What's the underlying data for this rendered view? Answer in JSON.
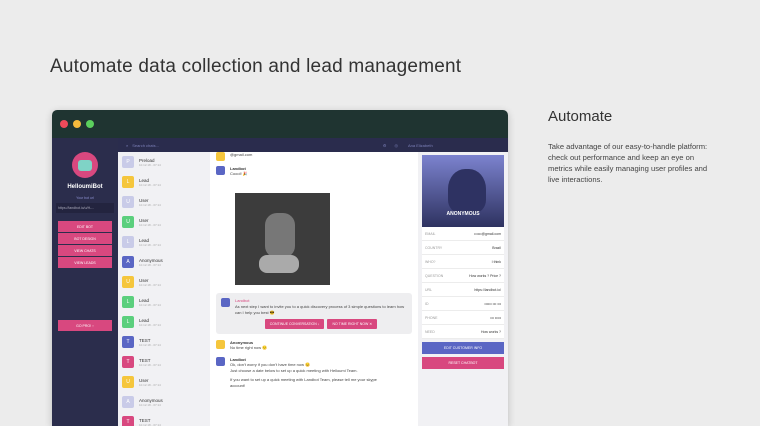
{
  "heading": "Automate data collection and lead management",
  "side": {
    "title": "Automate",
    "text": "Take advantage of our easy-to-handle platform: check out performance and keep an eye on metrics while easily managing user profiles and live interactions."
  },
  "sidebar": {
    "bot_name": "HelloumiBot",
    "link_label": "Your bot url",
    "url": "https://landbot.io/u/H-...",
    "buttons": [
      "EDIT BOT",
      "BOT DESIGN",
      "VIEW CHATS",
      "VIEW LEADS"
    ],
    "pro": "GO PRO! ↑"
  },
  "topbar": {
    "search": "Search chats...",
    "user": "Ana Elizabeth"
  },
  "list": [
    {
      "l": "P",
      "n": "Preload",
      "c": "#c9cbe8"
    },
    {
      "l": "L",
      "n": "Lead",
      "c": "#f5c63c"
    },
    {
      "l": "U",
      "n": "User",
      "c": "#c9cbe8"
    },
    {
      "l": "U",
      "n": "User",
      "c": "#5bcf7d"
    },
    {
      "l": "L",
      "n": "Lead",
      "c": "#c9cbe8"
    },
    {
      "l": "A",
      "n": "Anonymous",
      "c": "#5a66c4"
    },
    {
      "l": "U",
      "n": "User",
      "c": "#f5c63c"
    },
    {
      "l": "L",
      "n": "Lead",
      "c": "#5bcf7d"
    },
    {
      "l": "L",
      "n": "Lead",
      "c": "#5bcf7d"
    },
    {
      "l": "T",
      "n": "TEST",
      "c": "#5a66c4"
    },
    {
      "l": "T",
      "n": "TEST",
      "c": "#d8487f"
    },
    {
      "l": "U",
      "n": "User",
      "c": "#f5c63c"
    },
    {
      "l": "A",
      "n": "Anonymous",
      "c": "#c9cbe8"
    },
    {
      "l": "T",
      "n": "TEST",
      "c": "#d8487f"
    }
  ],
  "list_date": "10.12.18 - 07:14",
  "chat": {
    "email": "@gmail.com",
    "m1": {
      "name": "Landbot",
      "text": "Coool! 🎉"
    },
    "card": {
      "name": "Landbot",
      "text": "As next step I want to invite you to a quick discovery process of 3 simple questions to learn how can I help you best 😎",
      "b1": "CONTINUE CONVERSATION ↓",
      "b2": "NO TIME RIGHT NOW ✕"
    },
    "m2": {
      "name": "Anonymous",
      "text": "No time right now 😔"
    },
    "m3": {
      "name": "Landbot",
      "text": "Ok, don't worry if you don't have time now 😊",
      "text2": "Just choose a date below to set up a quick meeting with Helloumi Team.",
      "text3": "If you want to set up a quick meeting with Landbot Team, please tell me your skype account!"
    }
  },
  "profile": {
    "name": "ANONYMOUS",
    "rows": [
      {
        "k": "EMAIL",
        "v": "••••••@gmail.com"
      },
      {
        "k": "COUNTRY",
        "v": "Brazil"
      },
      {
        "k": "WHO?",
        "v": "I think"
      },
      {
        "k": "QUESTION",
        "v": "How works ? Price ?"
      },
      {
        "k": "URL",
        "v": "https://landbot.io/"
      },
      {
        "k": "ID",
        "v": "•••••• ••• •••"
      },
      {
        "k": "PHONE",
        "v": "••• •••••"
      },
      {
        "k": "NEED",
        "v": "How works ?"
      }
    ],
    "edit": "EDIT CUSTOMER INFO",
    "reset": "RESET CHATBOT"
  }
}
